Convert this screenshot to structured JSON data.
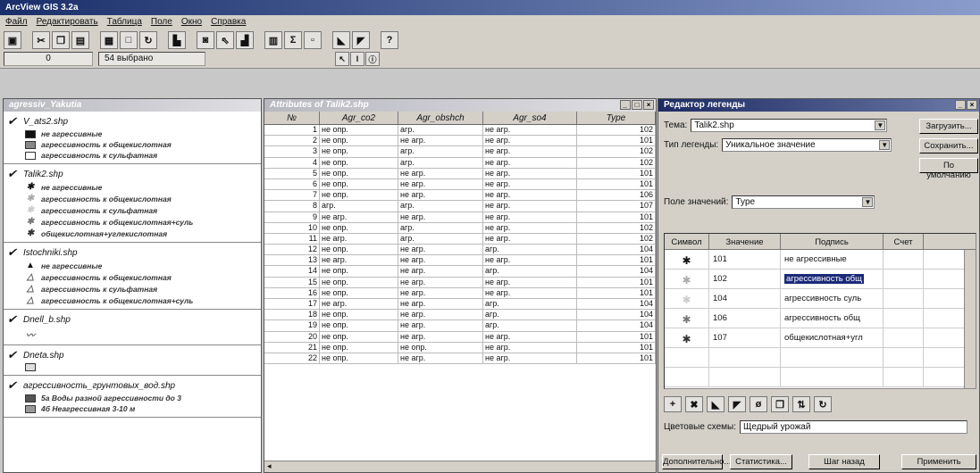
{
  "app": {
    "title": "ArcView GIS 3.2a"
  },
  "menu": [
    "Файл",
    "Редактировать",
    "Таблица",
    "Поле",
    "Окно",
    "Справка"
  ],
  "toolbar": {
    "record_field": "0",
    "selected_text": "54 выбрано"
  },
  "toc": {
    "title": "agressiv_Yakutia",
    "layers": [
      {
        "name": "V_ats2.shp",
        "items": [
          {
            "label": "не агрессивные",
            "color": "#111111",
            "symbol": "box"
          },
          {
            "label": "агрессивность к общекислотная",
            "color": "#888888",
            "symbol": "box"
          },
          {
            "label": "агрессивность к сульфатная",
            "color": "#ffffff",
            "symbol": "box"
          }
        ]
      },
      {
        "name": "Talik2.shp",
        "items": [
          {
            "label": "не агрессивные",
            "color": "#111111",
            "symbol": "asterisk"
          },
          {
            "label": "агрессивность к общекислотная",
            "color": "#aaaaaa",
            "symbol": "asterisk"
          },
          {
            "label": "агрессивность к сульфатная",
            "color": "#cccccc",
            "symbol": "asterisk"
          },
          {
            "label": "агрессивность к общекислотная+суль",
            "color": "#777777",
            "symbol": "asterisk"
          },
          {
            "label": "общекислотная+углекислотная",
            "color": "#333333",
            "symbol": "asterisk"
          }
        ]
      },
      {
        "name": "Istochniki.shp",
        "items": [
          {
            "label": "не агрессивные",
            "color": "#111111",
            "symbol": "triangle-filled"
          },
          {
            "label": "агрессивность к общекислотная",
            "color": "#555555",
            "symbol": "triangle"
          },
          {
            "label": "агрессивность к сульфатная",
            "color": "#555555",
            "symbol": "triangle"
          },
          {
            "label": "агрессивность к общекислотная+суль",
            "color": "#555555",
            "symbol": "triangle"
          }
        ]
      },
      {
        "name": "Dnell_b.shp",
        "items": [
          {
            "label": "",
            "color": "#555555",
            "symbol": "line"
          }
        ]
      },
      {
        "name": "Dneta.shp",
        "items": [
          {
            "label": "",
            "color": "#dddddd",
            "symbol": "box"
          }
        ]
      },
      {
        "name": "агрессивность_грунтовых_вод.shp",
        "items": [
          {
            "label": "5a  Воды разной агрессивности до 3",
            "color": "#555555",
            "symbol": "box"
          },
          {
            "label": "4б  Неагрессивная 3-10 м",
            "color": "#999999",
            "symbol": "box"
          }
        ]
      }
    ]
  },
  "attr_table": {
    "title": "Attributes of Talik2.shp",
    "columns": [
      "№",
      "Agr_co2",
      "Agr_obshch",
      "Agr_so4",
      "Type"
    ],
    "rows": [
      [
        "1",
        "не опр.",
        "агр.",
        "не агр.",
        "102"
      ],
      [
        "2",
        "не опр.",
        "не агр.",
        "не агр.",
        "101"
      ],
      [
        "3",
        "не опр.",
        "агр.",
        "не агр.",
        "102"
      ],
      [
        "4",
        "не опр.",
        "агр.",
        "не агр.",
        "102"
      ],
      [
        "5",
        "не опр.",
        "не агр.",
        "не агр.",
        "101"
      ],
      [
        "6",
        "не опр.",
        "не агр.",
        "не агр.",
        "101"
      ],
      [
        "7",
        "не опр.",
        "не агр.",
        "не агр.",
        "106"
      ],
      [
        "8",
        "агр.",
        "агр.",
        "не агр.",
        "107"
      ],
      [
        "9",
        "не агр.",
        "не агр.",
        "не агр.",
        "101"
      ],
      [
        "10",
        "не опр.",
        "агр.",
        "не агр.",
        "102"
      ],
      [
        "11",
        "не агр.",
        "агр.",
        "не агр.",
        "102"
      ],
      [
        "12",
        "не опр.",
        "не агр.",
        "агр.",
        "104"
      ],
      [
        "13",
        "не агр.",
        "не агр.",
        "не агр.",
        "101"
      ],
      [
        "14",
        "не опр.",
        "не агр.",
        "агр.",
        "104"
      ],
      [
        "15",
        "не опр.",
        "не агр.",
        "не агр.",
        "101"
      ],
      [
        "16",
        "не опр.",
        "не агр.",
        "не агр.",
        "101"
      ],
      [
        "17",
        "не агр.",
        "не агр.",
        "агр.",
        "104"
      ],
      [
        "18",
        "не опр.",
        "не агр.",
        "агр.",
        "104"
      ],
      [
        "19",
        "не опр.",
        "не агр.",
        "агр.",
        "104"
      ],
      [
        "20",
        "не опр.",
        "не агр.",
        "не агр.",
        "101"
      ],
      [
        "21",
        "не опр.",
        "не опр.",
        "не агр.",
        "101"
      ],
      [
        "22",
        "не опр.",
        "не агр.",
        "не агр.",
        "101"
      ]
    ]
  },
  "legend_editor": {
    "title": "Редактор легенды",
    "theme_label": "Тема:",
    "theme_value": "Talik2.shp",
    "legend_type_label": "Тип легенды:",
    "legend_type_value": "Уникальное значение",
    "field_label": "Поле значений:",
    "field_value": "Type",
    "load_button": "Загрузить...",
    "save_button": "Сохранить...",
    "default_button": "По умолчанию",
    "columns": [
      "Символ",
      "Значение",
      "Подпись",
      "Счет"
    ],
    "rows": [
      {
        "value": "101",
        "label": "не агрессивные",
        "color": "#111111",
        "selected": false
      },
      {
        "value": "102",
        "label": "агрессивность общ",
        "color": "#aaaaaa",
        "selected": true
      },
      {
        "value": "104",
        "label": "агрессивность суль",
        "color": "#cccccc",
        "selected": false
      },
      {
        "value": "106",
        "label": "агрессивность общ",
        "color": "#777777",
        "selected": false
      },
      {
        "value": "107",
        "label": "общекислотная+угл",
        "color": "#333333",
        "selected": false
      }
    ],
    "color_scheme_label": "Цветовые схемы:",
    "color_scheme_value": "Щедрый урожай",
    "advanced_button": "Дополнительно...",
    "statistics_button": "Статистика...",
    "undo_button": "Шаг назад",
    "apply_button": "Применить"
  }
}
